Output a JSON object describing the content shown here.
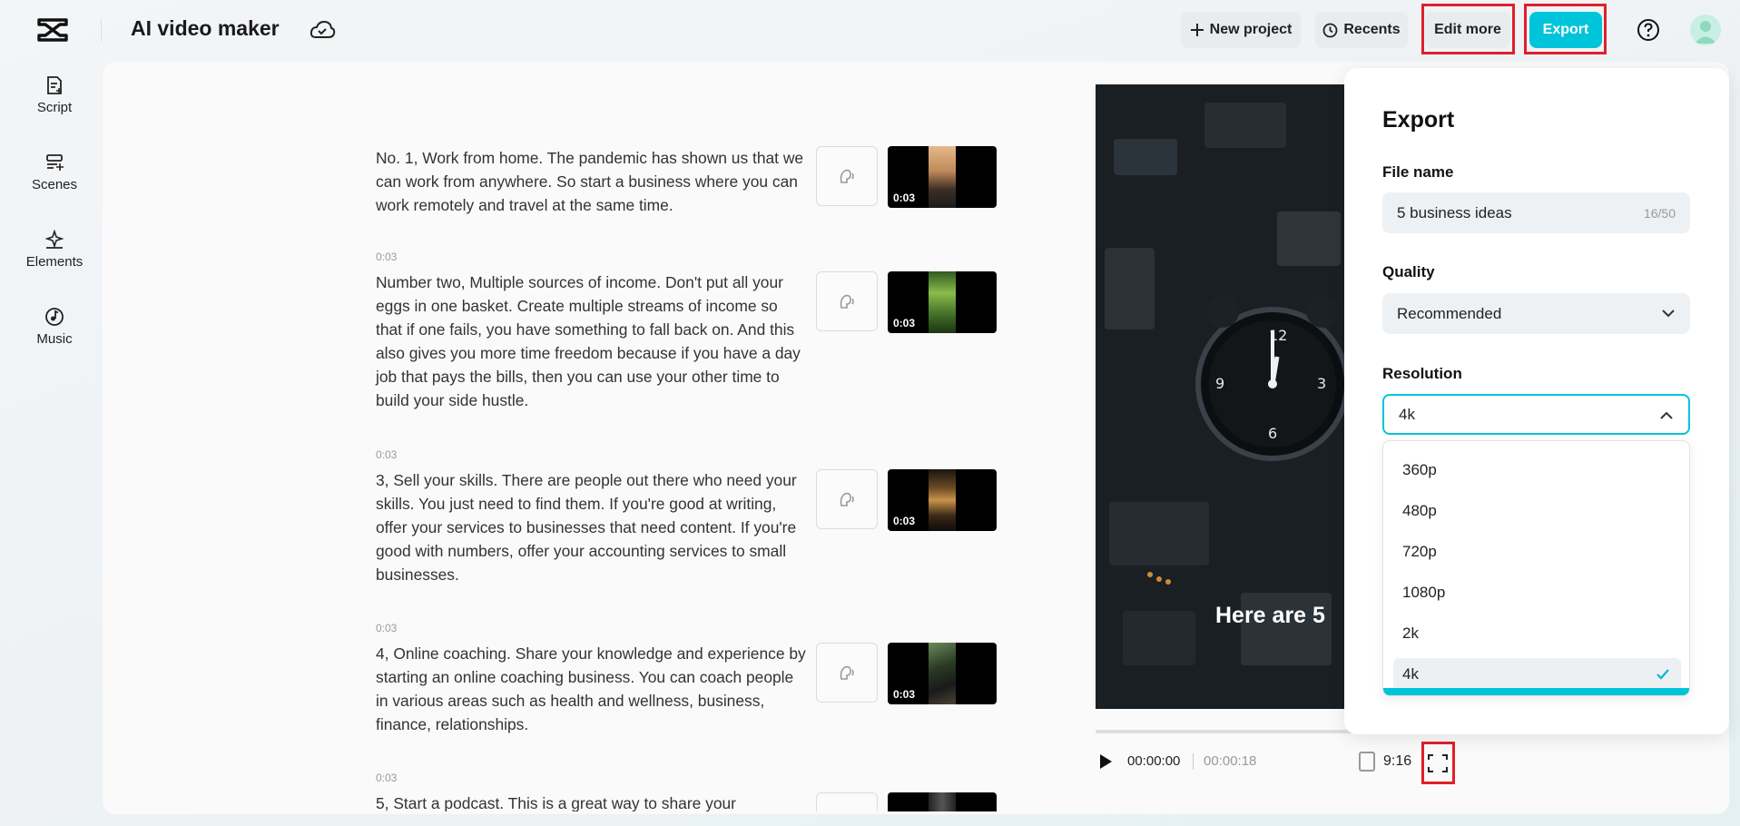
{
  "app": {
    "title": "AI video maker"
  },
  "toolbar": {
    "new_project": "New project",
    "recents": "Recents",
    "edit_more": "Edit more",
    "export": "Export"
  },
  "sidebar": {
    "items": [
      {
        "label": "Script",
        "icon": "script-icon"
      },
      {
        "label": "Scenes",
        "icon": "scenes-icon"
      },
      {
        "label": "Elements",
        "icon": "elements-icon"
      },
      {
        "label": "Music",
        "icon": "music-icon"
      }
    ]
  },
  "script": {
    "blocks": [
      {
        "timestamp": "",
        "text": "No. 1, Work from home. The pandemic has shown us that we can work from anywhere. So start a business where you can work remotely and travel at the same time.",
        "duration": "0:03"
      },
      {
        "timestamp": "0:03",
        "text": "Number two, Multiple sources of income. Don't put all your eggs in one basket. Create multiple streams of income so that if one fails, you have something to fall back on. And this also gives you more time freedom because if you have a day job that pays the bills, then you can use your other time to build your side hustle.",
        "duration": "0:03"
      },
      {
        "timestamp": "0:03",
        "text": "3, Sell your skills. There are people out there who need your skills. You just need to find them. If you're good at writing, offer your services to businesses that need content. If you're good with numbers, offer your accounting services to small businesses.",
        "duration": "0:03"
      },
      {
        "timestamp": "0:03",
        "text": "4, Online coaching. Share your knowledge and experience by starting an online coaching business. You can coach people in various areas such as health and wellness, business, finance, relationships.",
        "duration": "0:03"
      },
      {
        "timestamp": "0:03",
        "text": "5, Start a podcast. This is a great way to share your",
        "duration": ""
      }
    ]
  },
  "preview": {
    "caption": "Here are 5",
    "current_time": "00:00:00",
    "total_time": "00:00:18",
    "aspect_ratio": "9:16"
  },
  "export_panel": {
    "title": "Export",
    "file_name_label": "File name",
    "file_name_value": "5 business ideas",
    "file_name_counter": "16/50",
    "quality_label": "Quality",
    "quality_value": "Recommended",
    "resolution_label": "Resolution",
    "resolution_value": "4k",
    "resolution_options": [
      "360p",
      "480p",
      "720p",
      "1080p",
      "2k",
      "4k"
    ],
    "resolution_selected": "4k",
    "accent_color": "#00c4d9"
  }
}
